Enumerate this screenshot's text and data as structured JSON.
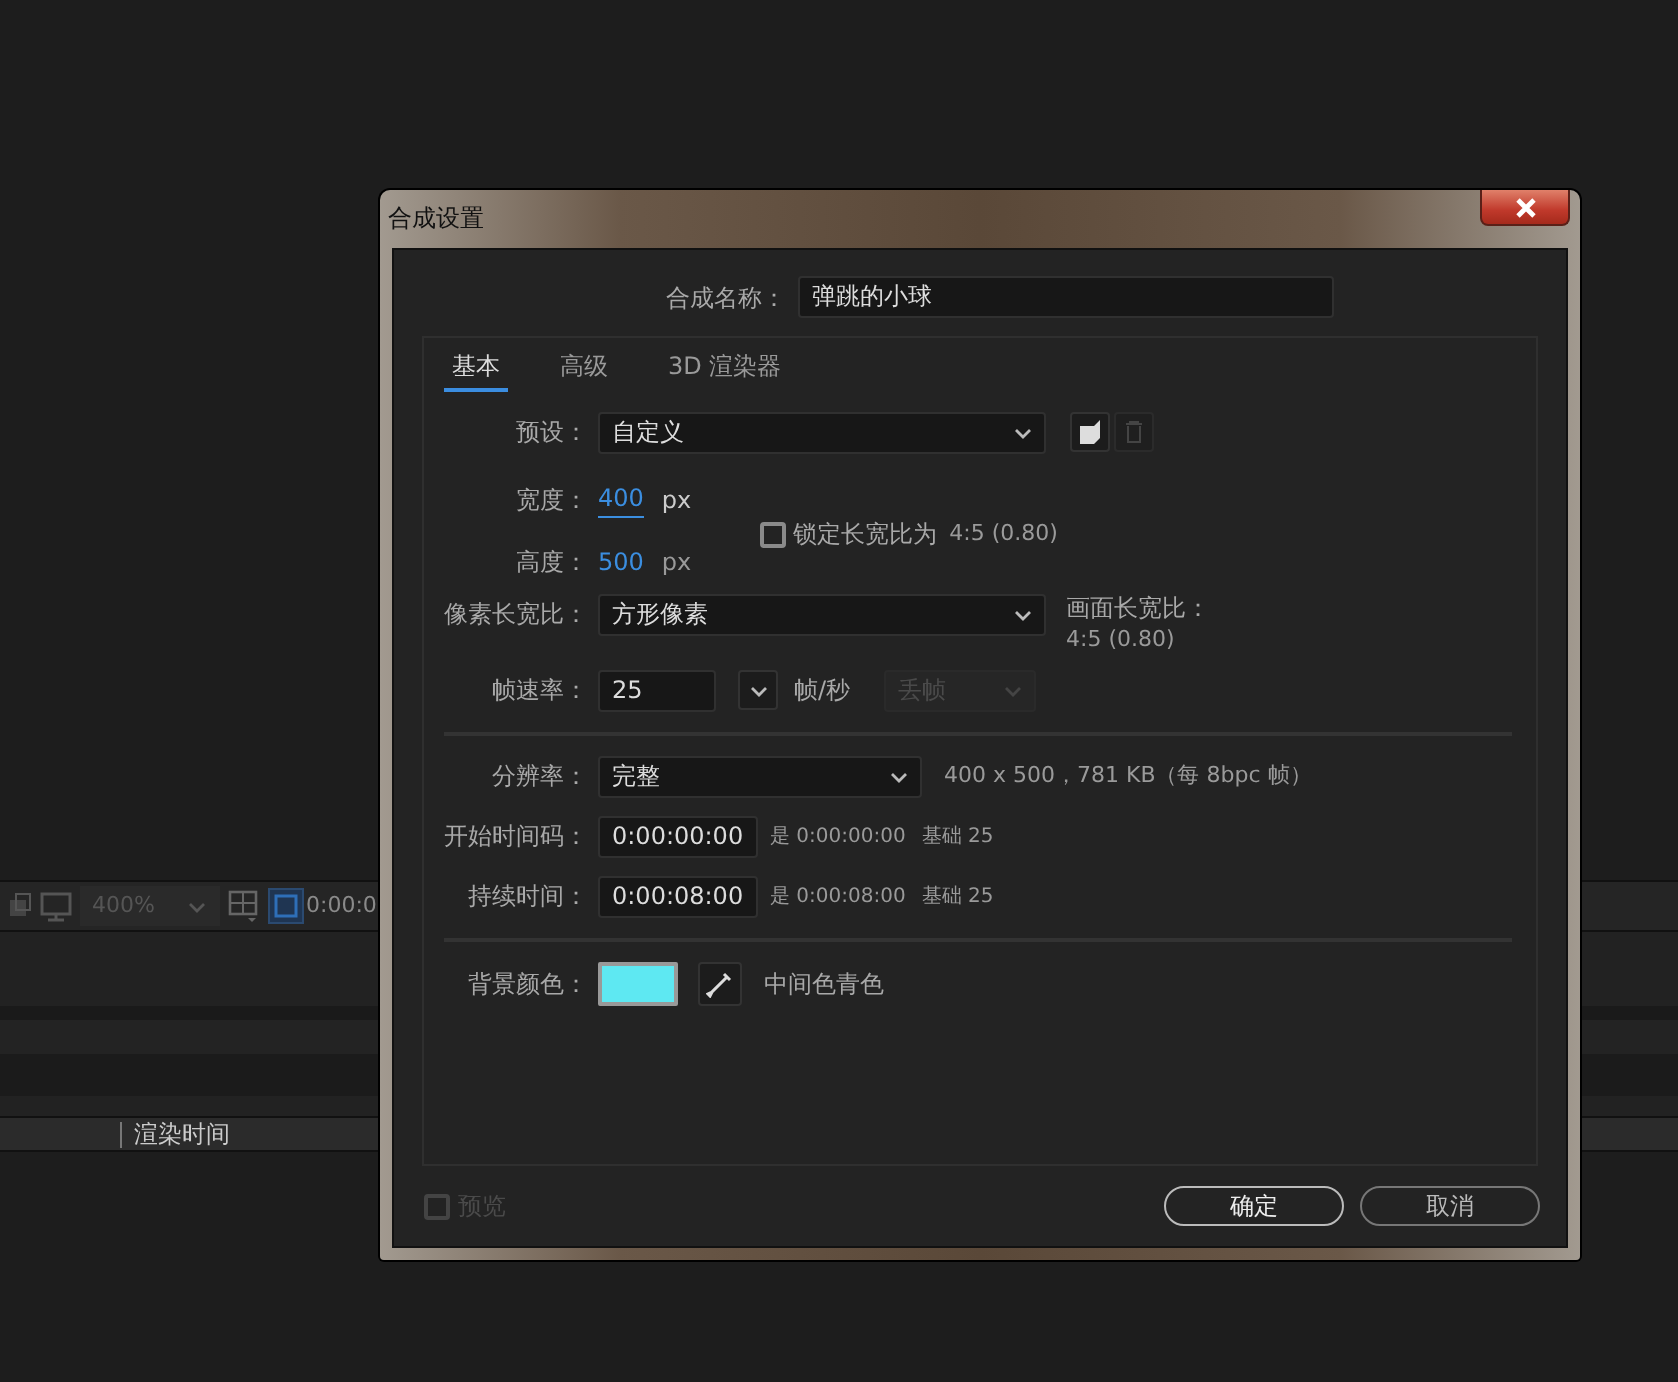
{
  "background_app": {
    "zoom": "400%",
    "timecode": "0:00:0",
    "column_header": "渲染时间"
  },
  "dialog": {
    "title": "合成设置",
    "name": {
      "label": "合成名称：",
      "value": "弹跳的小球"
    },
    "tabs": [
      {
        "label": "基本",
        "selected": true
      },
      {
        "label": "高级",
        "selected": false
      },
      {
        "label": "3D 渲染器",
        "selected": false
      }
    ],
    "preset": {
      "label": "预设：",
      "value": "自定义"
    },
    "width": {
      "label": "宽度：",
      "value": "400",
      "unit": "px"
    },
    "height": {
      "label": "高度：",
      "value": "500",
      "unit": "px"
    },
    "lock_aspect": {
      "label": "锁定长宽比为",
      "value": "4:5 (0.80)",
      "checked": false
    },
    "pixel_aspect": {
      "label": "像素长宽比：",
      "value": "方形像素"
    },
    "frame_aspect": {
      "label": "画面长宽比：",
      "value": "4:5 (0.80)"
    },
    "frame_rate": {
      "label": "帧速率：",
      "value": "25",
      "unit": "帧/秒",
      "drop_frame": "丢帧",
      "drop_frame_disabled": true
    },
    "resolution": {
      "label": "分辨率：",
      "value": "完整",
      "info": "400 x 500，781 KB（每 8bpc 帧）"
    },
    "start_timecode": {
      "label": "开始时间码：",
      "value": "0:00:00:00",
      "equals": "是 0:00:00:00",
      "base": "基础 25"
    },
    "duration": {
      "label": "持续时间：",
      "value": "0:00:08:00",
      "equals": "是 0:00:08:00",
      "base": "基础 25"
    },
    "background_color": {
      "label": "背景颜色：",
      "color": "#5ee8f2",
      "name": "中间色青色"
    },
    "preview": {
      "label": "预览",
      "checked": false,
      "disabled": true
    },
    "buttons": [
      "确定",
      "取消"
    ]
  }
}
